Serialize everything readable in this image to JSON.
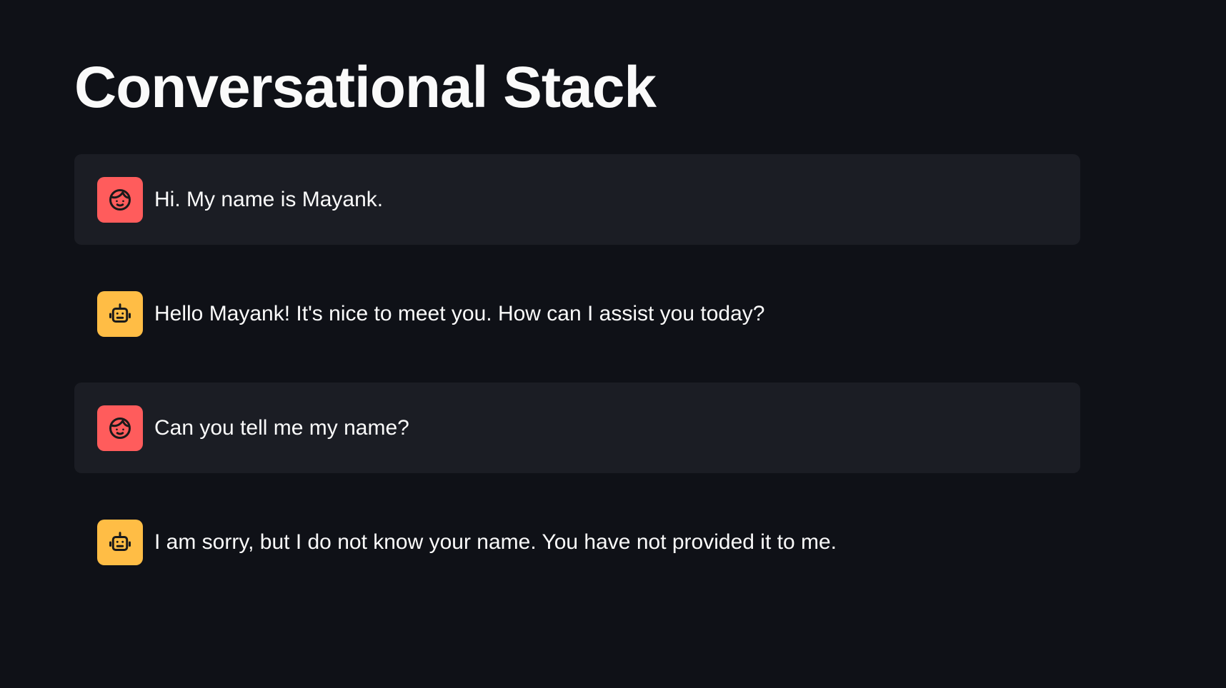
{
  "page": {
    "title": "Conversational Stack"
  },
  "colors": {
    "background": "#0f1117",
    "user_bubble": "#1b1d24",
    "user_avatar": "#ff5c5c",
    "assistant_avatar": "#ffbd45",
    "text": "#fafafa"
  },
  "messages": [
    {
      "role": "user",
      "icon": "user-face-icon",
      "text": "Hi. My name is Mayank."
    },
    {
      "role": "assistant",
      "icon": "robot-icon",
      "text": "Hello Mayank! It's nice to meet you. How can I assist you today?"
    },
    {
      "role": "user",
      "icon": "user-face-icon",
      "text": "Can you tell me my name?"
    },
    {
      "role": "assistant",
      "icon": "robot-icon",
      "text": "I am sorry, but I do not know your name. You have not provided it to me."
    }
  ]
}
